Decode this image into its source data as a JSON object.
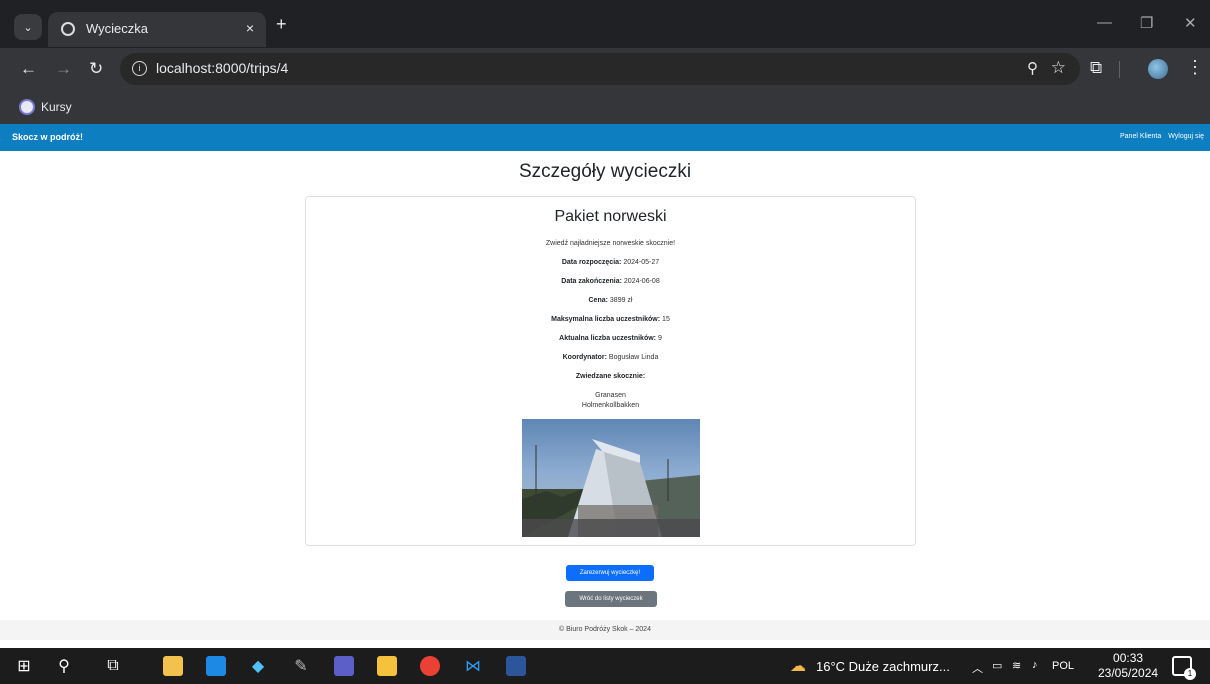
{
  "browser": {
    "tab": {
      "title": "Wycieczka",
      "close": "×"
    },
    "new_tab": "+",
    "url": "localhost:8000/trips/4",
    "bookmarks": [
      {
        "label": "Kursy"
      }
    ],
    "window_controls": {
      "minimize": "—",
      "restore": "❐",
      "close": "✕"
    }
  },
  "navbar": {
    "brand": "Skocz w podróż!",
    "links": [
      "Panel Klienta",
      "Wyloguj się"
    ]
  },
  "page": {
    "title": "Szczegóły wycieczki",
    "trip": {
      "name": "Pakiet norweski",
      "description": "Zwiedź najładniejsze norweskie skocznie!",
      "start_label": "Data rozpoczęcia:",
      "start_value": "2024-05-27",
      "end_label": "Data zakończenia:",
      "end_value": "2024-06-08",
      "price_label": "Cena:",
      "price_value": "3899 zł",
      "max_label": "Maksymalna liczba uczestników:",
      "max_value": "15",
      "current_label": "Aktualna liczba uczestników:",
      "current_value": "9",
      "coordinator_label": "Koordynator:",
      "coordinator_value": "Bogusław Linda",
      "hills_label": "Zwiedzane skocznie:",
      "hills": [
        "Granasen",
        "Holmenkollbakken"
      ]
    },
    "buttons": {
      "book": "Zarezerwuj wycieczkę!",
      "back": "Wróć do listy wycieczek"
    },
    "footer": "© Biuro Podróży Skok – 2024"
  },
  "taskbar": {
    "weather": "16°C  Duże zachmurz...",
    "language": "POL",
    "time": "00:33",
    "date": "23/05/2024",
    "notifications": "1"
  },
  "colors": {
    "navbar": "#0d7fc0",
    "primary_button": "#0d6efd",
    "secondary_button": "#6c757d"
  }
}
